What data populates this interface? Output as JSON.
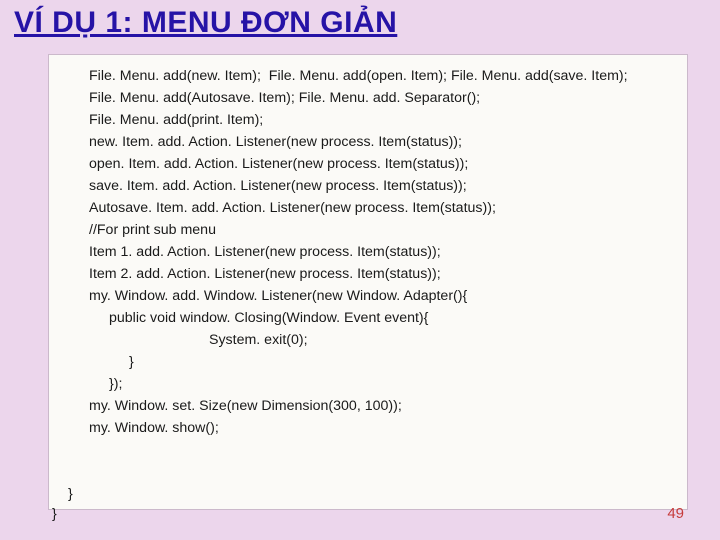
{
  "title": "VÍ DỤ 1: MENU ĐƠN GIẢN",
  "code": {
    "l1": "File. Menu. add(new. Item);  File. Menu. add(open. Item); File. Menu. add(save. Item);",
    "l2": "File. Menu. add(Autosave. Item); File. Menu. add. Separator();",
    "l3": "File. Menu. add(print. Item);",
    "l4": "new. Item. add. Action. Listener(new process. Item(status));",
    "l5": "open. Item. add. Action. Listener(new process. Item(status));",
    "l6": "save. Item. add. Action. Listener(new process. Item(status));",
    "l7": "Autosave. Item. add. Action. Listener(new process. Item(status));",
    "l8": "//For print sub menu",
    "l9": "Item 1. add. Action. Listener(new process. Item(status));",
    "l10": "Item 2. add. Action. Listener(new process. Item(status));",
    "l11": "my. Window. add. Window. Listener(new Window. Adapter(){",
    "l12": "public void window. Closing(Window. Event event){",
    "l13": "System. exit(0);",
    "l14": "}",
    "l15": "});",
    "l16": "my. Window. set. Size(new Dimension(300, 100));",
    "l17": "my. Window. show();",
    "close1": "}",
    "close0": "}"
  },
  "pagenum": "49"
}
